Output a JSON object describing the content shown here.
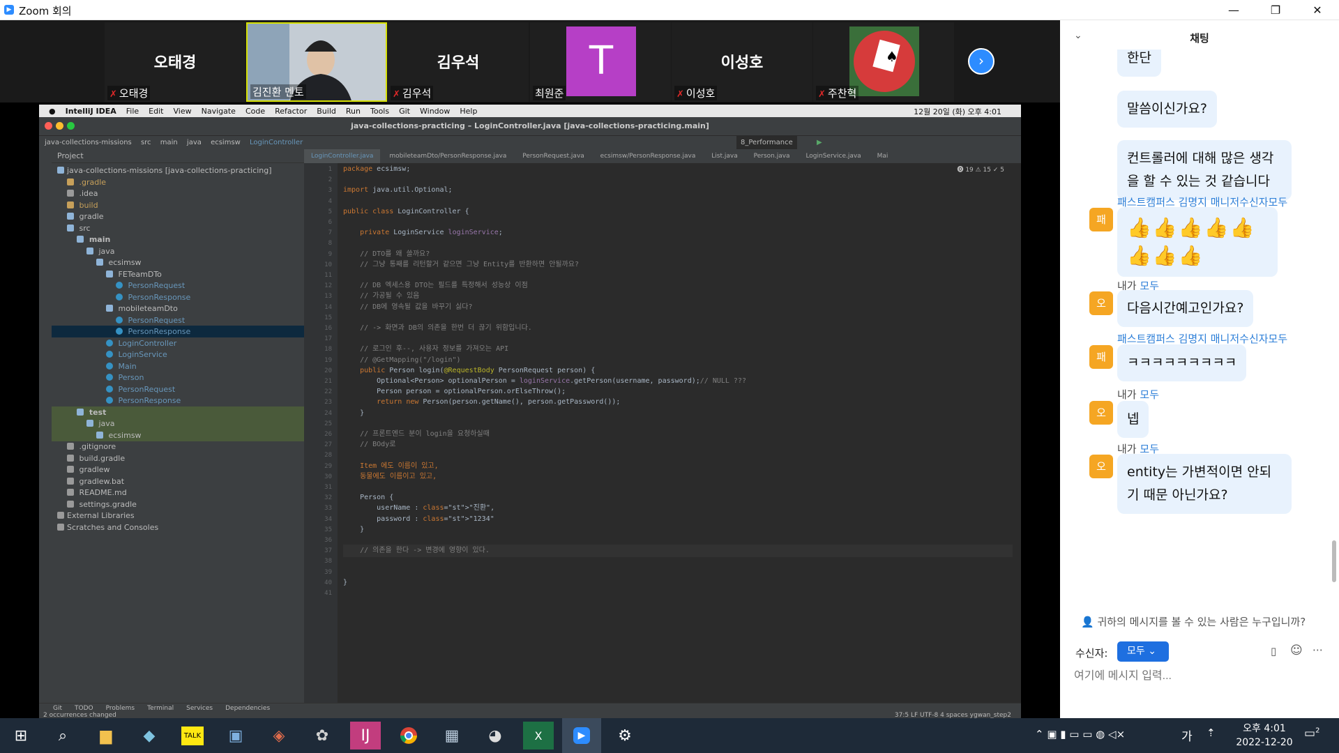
{
  "window": {
    "title": "Zoom 회의",
    "min": "—",
    "max": "❐",
    "close": "✕"
  },
  "participants": [
    {
      "big": "오태경",
      "label": "오태경"
    },
    {
      "label": "김진환 멘토"
    },
    {
      "big": "김우석",
      "label": "김우석"
    },
    {
      "letter": "T",
      "label": "최원준"
    },
    {
      "big": "이성호",
      "label": "이성호"
    },
    {
      "label": "주찬혁"
    }
  ],
  "ide": {
    "menu": [
      "IntelliJ IDEA",
      "File",
      "Edit",
      "View",
      "Navigate",
      "Code",
      "Refactor",
      "Build",
      "Run",
      "Tools",
      "Git",
      "Window",
      "Help"
    ],
    "clock": "12월 20일 (화) 오후 4:01",
    "title": "java-collections-practicing – LoginController.java [java-collections-practicing.main]",
    "breadcrumb": [
      "java-collections-missions",
      "src",
      "main",
      "java",
      "ecsimsw",
      "LoginController"
    ],
    "run_config": "8_Performance",
    "project_header": "Project",
    "tree": [
      "java-collections-missions [java-collections-practicing]",
      "  .gradle",
      "  .idea",
      "  build",
      "  gradle",
      "  src",
      "    main",
      "      java",
      "        ecsimsw",
      "          FETeamDTo",
      "            PersonRequest",
      "            PersonResponse",
      "          mobileteamDto",
      "            PersonRequest",
      "            PersonResponse",
      "          LoginController",
      "          LoginService",
      "          Main",
      "          Person",
      "          PersonRequest",
      "          PersonResponse",
      "    test",
      "      java",
      "        ecsimsw",
      "  .gitignore",
      "  build.gradle",
      "  gradlew",
      "  gradlew.bat",
      "  README.md",
      "  settings.gradle",
      "External Libraries",
      "Scratches and Consoles"
    ],
    "tabs": [
      "LoginController.java",
      "mobileteamDto/PersonResponse.java",
      "PersonRequest.java",
      "ecsimsw/PersonResponse.java",
      "List.java",
      "Person.java",
      "LoginService.java",
      "Mai"
    ],
    "inspections": "⓿ 19  ⚠ 15  ✓ 5",
    "code": [
      "package ecsimsw;",
      "",
      "import java.util.Optional;",
      "",
      "public class LoginController {",
      "",
      "    private LoginService loginService;",
      "",
      "    // DTO를 왜 쓸까요?",
      "    // 그냥 통째를 리턴할거 같으면 그냥 Entity를 반환하면 안될까요?",
      "",
      "    // DB 엑세스용 DTO는 필드를 특정해서 성능상 이점",
      "    // 가공될 수 있음",
      "    // DB에 영속될 값을 바꾸기 싫다?",
      "",
      "    // -> 화면과 DB의 의존을 한번 더 끊기 위함입니다.",
      "",
      "    // 로그인 후--, 사용자 정보를 가져오는 API",
      "    // @GetMapping(\"/login\")",
      "    public Person login(@RequestBody PersonRequest person) {",
      "        Optional<Person> optionalPerson = loginService.getPerson(username, password);// NULL ???",
      "        Person person = optionalPerson.orElseThrow();",
      "        return new Person(person.getName(), person.getPassword());",
      "    }",
      "",
      "    // 프론트엔드 분이 login을 요청하실때",
      "    // BOdy로",
      "",
      "    Item 에도 이름이 있고,",
      "    동물에도 이름이고 있고,",
      "",
      "    Person {",
      "        userName : \"진환\",",
      "        password : \"1234\"",
      "    }",
      "",
      "    // 의존을 한다 -> 변경에 영향이 있다.",
      "",
      "",
      "}",
      ""
    ],
    "bottom_tools": [
      "Git",
      "TODO",
      "Problems",
      "Terminal",
      "Services",
      "Dependencies"
    ],
    "status_left": "2 occurrences changed",
    "status_right": "37:5  LF  UTF-8  4 spaces  ygwan_step2"
  },
  "chat": {
    "title": "채팅",
    "messages": [
      {
        "type": "cont",
        "text": "한단"
      },
      {
        "type": "cont",
        "text": "말씀이신가요?"
      },
      {
        "type": "cont",
        "text": "컨트롤러에 대해 많은 생각을 할 수 있는 것 같습니다"
      },
      {
        "type": "head",
        "from": "패스트캠퍼스 김명지 매니저",
        "to": "수신자",
        "to2": "모두",
        "avatar": "패",
        "text": "👍👍👍👍👍👍👍👍"
      },
      {
        "type": "head",
        "from": "내가",
        "to": "",
        "to2": "모두",
        "avatar": "오",
        "text": "다음시간예고인가요?"
      },
      {
        "type": "head",
        "from": "패스트캠퍼스 김명지 매니저",
        "to": "수신자",
        "to2": "모두",
        "avatar": "패",
        "text": "ㅋㅋㅋㅋㅋㅋㅋㅋㅋ"
      },
      {
        "type": "head",
        "from": "내가",
        "to": "",
        "to2": "모두",
        "avatar": "오",
        "text": "넵"
      },
      {
        "type": "head",
        "from": "내가",
        "to": "",
        "to2": "모두",
        "avatar": "오",
        "text": "entity는 가변적이면 안되기 때문 아닌가요?"
      }
    ],
    "visibility": "귀하의 메시지를 볼 수 있는 사람은 누구입니까?",
    "recipient_label": "수신자:",
    "recipient": "모두",
    "placeholder": "여기에 메시지 입력..."
  },
  "taskbar": {
    "time": "오후 4:01",
    "date": "2022-12-20",
    "ime": "가",
    "notif": "2"
  }
}
